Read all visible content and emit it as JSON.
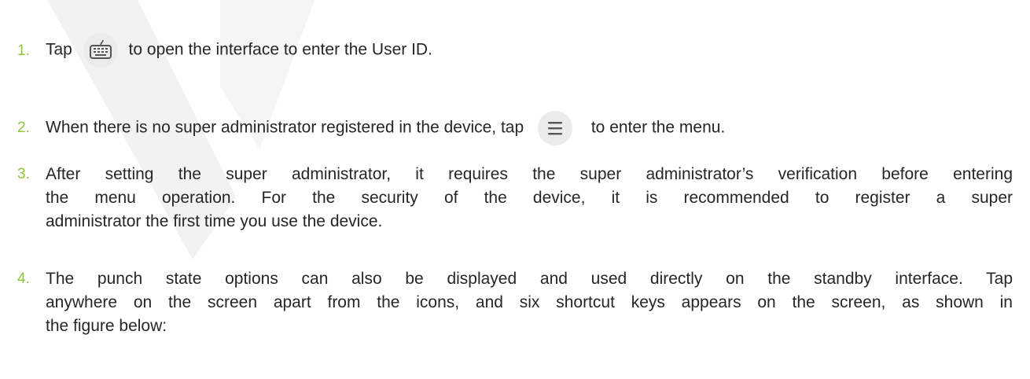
{
  "colors": {
    "number": "#8cc63f",
    "text": "#262626",
    "icon_bg": "#ebebeb",
    "watermark": "#f0f0f0"
  },
  "icons": {
    "keyboard": "keyboard-icon",
    "menu": "hamburger-menu-icon"
  },
  "steps": [
    {
      "number": "1.",
      "before": "Tap",
      "after": "to open the interface to enter the User ID."
    },
    {
      "number": "2.",
      "before": "When there is no super administrator registered in the device, tap",
      "after": "to enter the menu."
    },
    {
      "number": "3.",
      "lines": [
        "After setting the super administrator, it requires the super administrator’s verification before entering",
        "the menu operation. For the security of the device, it is recommended to register a super",
        "administrator the first time you use the device."
      ]
    },
    {
      "number": "4.",
      "lines": [
        "The punch state options can also be displayed and used directly on the standby interface. Tap",
        "anywhere on the screen apart from the icons, and six shortcut keys appears on the screen, as shown in",
        "the figure below:"
      ]
    }
  ]
}
